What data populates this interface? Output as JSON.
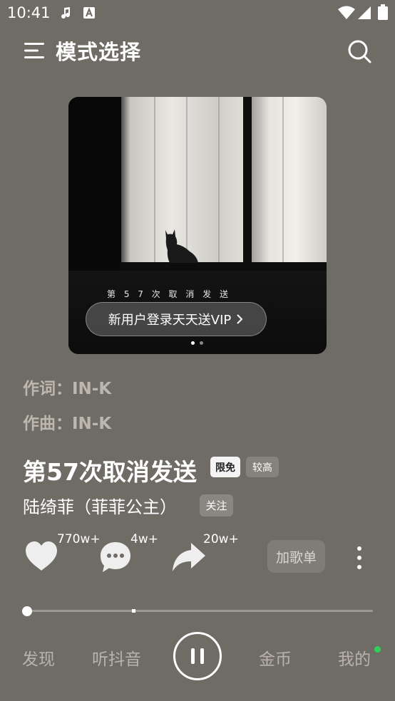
{
  "status_bar": {
    "time": "10:41"
  },
  "header": {
    "title": "模式选择",
    "menu_icon": "menu-icon",
    "search_icon": "search-icon"
  },
  "album": {
    "lyric_text": "第 5 7 次 取 消 发 送",
    "vip_text": "新用户登录天天送VIP",
    "page_dots": 2,
    "active_dot": 1
  },
  "credits": {
    "lyricist": "作词：IN-K",
    "composer": "作曲：IN-K"
  },
  "song": {
    "title": "第57次取消发送",
    "badge_free": "限免",
    "badge_quality": "较高",
    "artist": "陆绮菲（菲菲公主）",
    "follow_label": "关注"
  },
  "actions": {
    "like_count": "770w+",
    "comment_count": "4w+",
    "share_count": "20w+",
    "add_playlist_label": "加歌单"
  },
  "progress": {
    "played_fraction": 0.0
  },
  "nav": {
    "items": [
      "发现",
      "听抖音",
      "金币",
      "我的"
    ]
  },
  "colors": {
    "background": "#6f6b65",
    "accent_green": "#2bd25a"
  }
}
